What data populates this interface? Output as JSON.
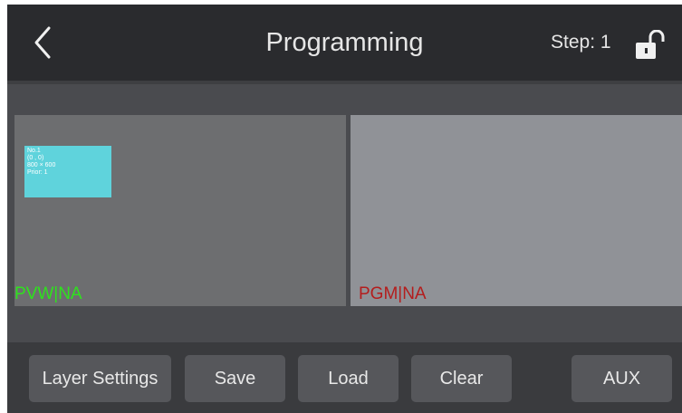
{
  "header": {
    "title": "Programming",
    "step_label": "Step: 1"
  },
  "icons": {
    "back": "chevron-left-icon",
    "lock": "unlock-icon"
  },
  "preview": {
    "pvw_label": "PVW|NA",
    "pgm_label": "PGM|NA",
    "layer": {
      "line1": "No.1",
      "line2": "(0 , 0)",
      "line3": "800 × 600",
      "line4": "Prior: 1"
    }
  },
  "toolbar": {
    "layer_settings": "Layer Settings",
    "save": "Save",
    "load": "Load",
    "clear": "Clear",
    "aux": "AUX"
  },
  "colors": {
    "pvw_label": "#2ee21d",
    "pgm_label": "#b41d1d",
    "layer_box": "#5fd3dc"
  }
}
